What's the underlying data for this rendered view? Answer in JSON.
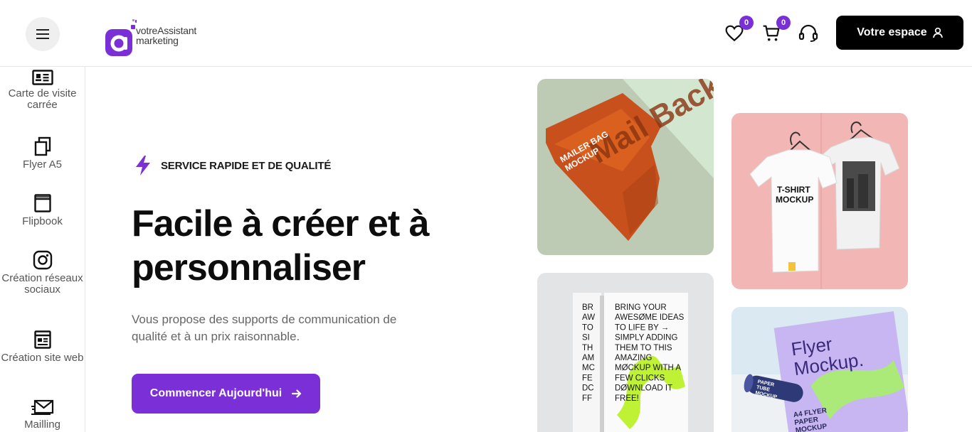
{
  "header": {
    "logo": {
      "line1": "votreAssistant",
      "line2": "marketing",
      "brand_color": "#7b2fd6"
    },
    "icons": {
      "menu": "hamburger-icon",
      "favorites": "heart-icon",
      "cart": "cart-icon",
      "support": "headset-icon",
      "user": "user-icon"
    },
    "favorites_count": "0",
    "cart_count": "0",
    "espace_label": "Votre espace"
  },
  "sidebar": {
    "items": [
      {
        "label": "Carte de visite carrée",
        "icon": "id-card-icon"
      },
      {
        "label": "Flyer A5",
        "icon": "copy-icon"
      },
      {
        "label": "Flipbook",
        "icon": "book-icon"
      },
      {
        "label": "Création réseaux sociaux",
        "icon": "instagram-icon"
      },
      {
        "label": "Création site web",
        "icon": "newspaper-icon"
      },
      {
        "label": "Mailling",
        "icon": "mail-icon"
      }
    ]
  },
  "hero": {
    "service_icon": "lightning-icon",
    "service_label": "SERVICE RAPIDE ET DE QUALITÉ",
    "title": "Facile à créer et à personnaliser",
    "subtitle": "Vous propose des supports de communication de qualité et à un prix raisonnable.",
    "cta_label": "Commencer Aujourd'hui",
    "cta_icon": "arrow-right-icon"
  },
  "gallery": {
    "mailer": {
      "line1": "MAILER BAG",
      "line2": "MOCKUP",
      "big": "Mail Back"
    },
    "tshirt": {
      "line1": "T-SHIRT",
      "line2": "MOCKUP"
    },
    "book": {
      "lines": [
        "BRING YOUR",
        "AWESØME IDEAS",
        "TO LIFE BY →",
        "SIMPLY ADDING",
        "THEM TO THIS",
        "AMAZING",
        "MØCKUP WITH A",
        "FEW CLICKS",
        "DØWNLOAD IT",
        "FREE!"
      ],
      "spine": [
        "BR",
        "AW",
        "TO",
        "SI",
        "TH",
        "AM",
        "MC",
        "FE",
        "DC",
        "FF"
      ]
    },
    "flyer": {
      "title1": "Flyer",
      "title2": "Mockup.",
      "tube1": "PAPER",
      "tube2": "TUBE",
      "tube3": "MOCKUP",
      "sub1": "A4 FLYER",
      "sub2": "PAPER",
      "sub3": "MOCKUP"
    }
  }
}
